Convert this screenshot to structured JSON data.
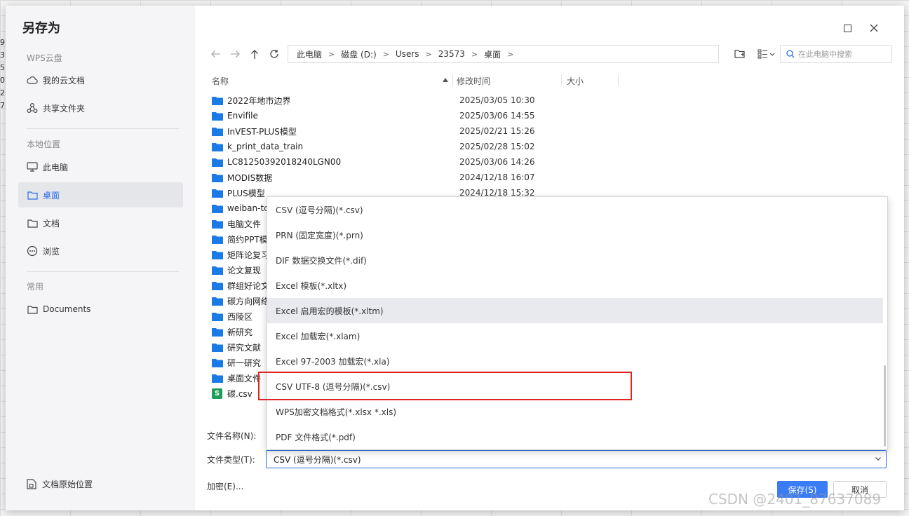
{
  "background": {
    "row_numbers": [
      "9",
      "3",
      "5",
      "0",
      "2",
      "7"
    ]
  },
  "dialog": {
    "title": "另存为",
    "maximize_icon": "maximize-icon",
    "close_icon": "close-icon"
  },
  "sidebar": {
    "cloud_section": "WPS云盘",
    "cloud_items": [
      {
        "label": "我的云文档",
        "icon": "cloud-icon"
      },
      {
        "label": "共享文件夹",
        "icon": "share-icon"
      }
    ],
    "local_section": "本地位置",
    "local_items": [
      {
        "label": "此电脑",
        "icon": "monitor-icon"
      },
      {
        "label": "桌面",
        "icon": "folder-icon"
      },
      {
        "label": "文档",
        "icon": "folder-icon"
      },
      {
        "label": "浏览",
        "icon": "more-icon"
      }
    ],
    "common_section": "常用",
    "common_items": [
      {
        "label": "Documents",
        "icon": "folder-icon"
      }
    ],
    "bottom_item": "文档原始位置"
  },
  "toolbar": {
    "breadcrumb": [
      "此电脑",
      "磁盘 (D:)",
      "Users",
      "23573",
      "桌面"
    ],
    "search_placeholder": "在此电脑中搜索"
  },
  "columns": {
    "name": "名称",
    "modified": "修改时间",
    "size": "大小"
  },
  "files": [
    {
      "name": "2022年地市边界",
      "date": "2025/03/05 10:30",
      "type": "folder"
    },
    {
      "name": "Envifile",
      "date": "2025/03/06 14:55",
      "type": "folder"
    },
    {
      "name": "InVEST-PLUS模型",
      "date": "2025/02/21 15:26",
      "type": "folder"
    },
    {
      "name": "k_print_data_train",
      "date": "2025/02/28 15:02",
      "type": "folder"
    },
    {
      "name": "LC81250392018240LGN00",
      "date": "2025/03/06 14:26",
      "type": "folder"
    },
    {
      "name": "MODIS数据",
      "date": "2024/12/18 16:07",
      "type": "folder"
    },
    {
      "name": "PLUS模型",
      "date": "2024/12/18 15:32",
      "type": "folder"
    },
    {
      "name": "weiban-tc",
      "date": "",
      "type": "folder"
    },
    {
      "name": "电脑文件",
      "date": "",
      "type": "folder"
    },
    {
      "name": "简约PPT模",
      "date": "",
      "type": "folder"
    },
    {
      "name": "矩阵论复习",
      "date": "",
      "type": "folder"
    },
    {
      "name": "论文复现",
      "date": "",
      "type": "folder"
    },
    {
      "name": "群组好论文",
      "date": "",
      "type": "folder"
    },
    {
      "name": "碳方向网络",
      "date": "",
      "type": "folder"
    },
    {
      "name": "西陵区",
      "date": "",
      "type": "folder"
    },
    {
      "name": "新研究",
      "date": "",
      "type": "folder"
    },
    {
      "name": "研究文献",
      "date": "",
      "type": "folder"
    },
    {
      "name": "研一研究",
      "date": "",
      "type": "folder"
    },
    {
      "name": "桌面文件",
      "date": "",
      "type": "folder"
    },
    {
      "name": "碳.csv",
      "date": "",
      "type": "csv"
    }
  ],
  "filename_label": "文件名称(N):",
  "filetype_label": "文件类型(T):",
  "filetype_selected": "CSV (逗号分隔)(*.csv)",
  "filetype_options": [
    "CSV (逗号分隔)(*.csv)",
    "PRN (固定宽度)(*.prn)",
    "DIF 数据交换文件(*.dif)",
    "Excel 模板(*.xltx)",
    "Excel 启用宏的模板(*.xltm)",
    "Excel 加载宏(*.xlam)",
    "Excel 97-2003 加载宏(*.xla)",
    "CSV UTF-8 (逗号分隔)(*.csv)",
    "WPS加密文档格式(*.xlsx *.xls)",
    "PDF 文件格式(*.pdf)"
  ],
  "encrypt_label": "加密(E)...",
  "save_label": "保存(S)",
  "cancel_label": "取消",
  "watermark": "CSDN @2401_87637089",
  "colors": {
    "accent": "#3a7cf5",
    "highlight": "#e02424",
    "folder": "#1a7ae6",
    "csv_icon": "#1e9c5a"
  }
}
